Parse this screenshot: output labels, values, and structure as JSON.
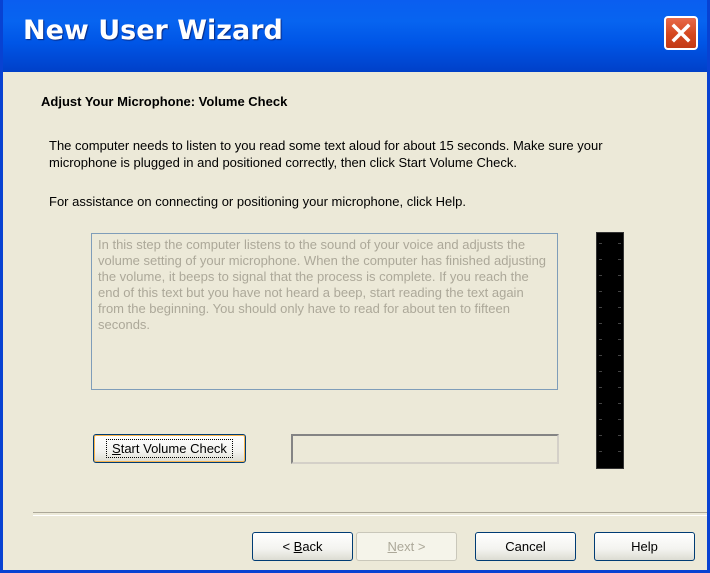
{
  "window": {
    "title": "New User Wizard"
  },
  "page": {
    "heading": "Adjust Your Microphone: Volume Check",
    "instruction": "The computer needs to listen to you read some text aloud for about 15 seconds.  Make sure your microphone is plugged in and positioned correctly, then click Start Volume Check.",
    "help_hint": "For assistance on connecting or positioning your microphone, click Help.",
    "reading_text": "In this step the computer listens to the sound of your voice and adjusts the volume setting of your microphone. When the computer has finished adjusting the volume, it beeps to signal that the process is complete. If you reach the end of this text but you have not heard a beep, start reading the text again from the beginning. You should only have to read for about ten to fifteen seconds."
  },
  "controls": {
    "start_volume_check": {
      "accel": "S",
      "rest": "tart Volume Check"
    },
    "volume_progress": 0,
    "volume_level": 0
  },
  "footer": {
    "back": {
      "prefix": "< ",
      "accel": "B",
      "rest": "ack"
    },
    "next": {
      "accel": "N",
      "rest": "ext >"
    },
    "cancel_label": "Cancel",
    "help_label": "Help"
  },
  "colors": {
    "titlebar": "#0055e6",
    "close_button": "#d4471f",
    "dialog_face": "#ece9d8",
    "meter_background": "#000000"
  },
  "icons": {
    "close": "close-icon"
  }
}
